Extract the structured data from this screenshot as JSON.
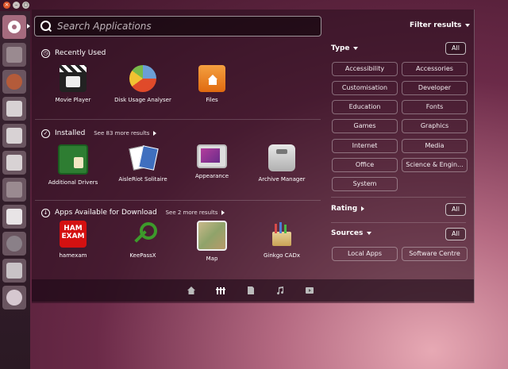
{
  "window_controls": {
    "close": "×",
    "minimize": "–",
    "maximize": "○"
  },
  "search": {
    "placeholder": "Search Applications"
  },
  "sections": {
    "recently_used": {
      "title": "Recently Used"
    },
    "installed": {
      "title": "Installed",
      "more": "See 83 more results"
    },
    "download": {
      "title": "Apps Available for Download",
      "more": "See 2 more results"
    }
  },
  "recent_apps": [
    {
      "label": "Movie Player",
      "icon": "clapperboard-icon"
    },
    {
      "label": "Disk Usage Analyser",
      "icon": "pie-chart-icon"
    },
    {
      "label": "Files",
      "icon": "home-folder-icon"
    }
  ],
  "installed_apps": [
    {
      "label": "Additional Drivers",
      "icon": "circuit-board-icon"
    },
    {
      "label": "AisleRiot Solitaire",
      "icon": "playing-cards-icon"
    },
    {
      "label": "Appearance",
      "icon": "monitor-icon"
    },
    {
      "label": "Archive Manager",
      "icon": "archive-icon"
    }
  ],
  "download_apps": [
    {
      "label": "hamexam",
      "icon": "ham-exam-icon",
      "icon_text": "HAM EXAM"
    },
    {
      "label": "KeePassX",
      "icon": "key-icon"
    },
    {
      "label": "Map",
      "icon": "map-icon"
    },
    {
      "label": "Ginkgo CADx",
      "icon": "ginkgo-icon"
    }
  ],
  "filter": {
    "title": "Filter results",
    "type_label": "Type",
    "rating_label": "Rating",
    "sources_label": "Sources",
    "all_label": "All",
    "types": [
      "Accessibility",
      "Accessories",
      "Customisation",
      "Developer",
      "Education",
      "Fonts",
      "Games",
      "Graphics",
      "Internet",
      "Media",
      "Office",
      "Science & Engin...",
      "System"
    ],
    "sources": [
      "Local Apps",
      "Software Centre"
    ]
  },
  "lenses": [
    "home-icon",
    "applications-icon",
    "files-icon",
    "music-icon",
    "video-icon"
  ],
  "colors": {
    "accent": "#a56b7e",
    "background": "#3c1428"
  }
}
